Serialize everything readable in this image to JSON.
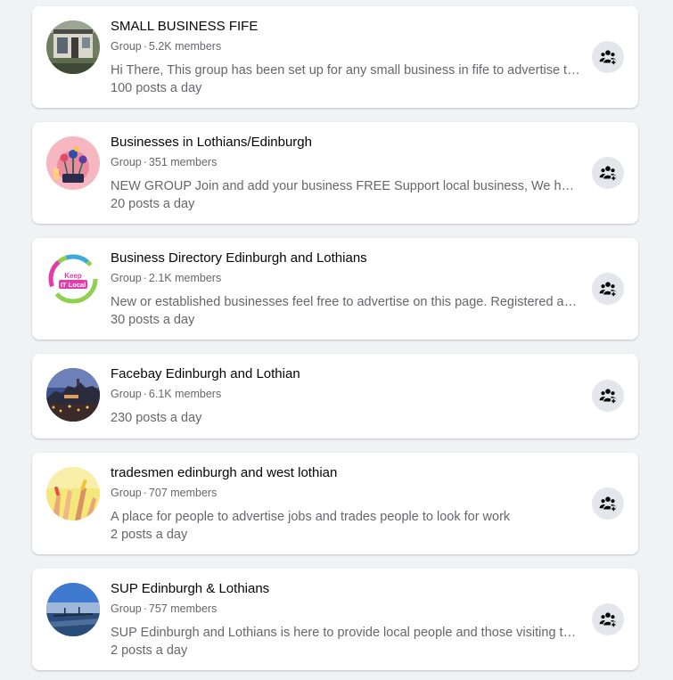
{
  "groups": [
    {
      "name": "SMALL BUSINESS FIFE",
      "type": "Group",
      "members": "5.2K members",
      "description": "Hi There, This group has been set up for any small business in fife to advertise their business and services",
      "activity": "100 posts a day",
      "avatar": "shop-storefront-photo",
      "action_icon": "join-group-icon"
    },
    {
      "name": "Businesses in Lothians/Edinburgh",
      "type": "Group",
      "members": "351 members",
      "description": "NEW GROUP Join and add your business FREE Support local business, We have created this group",
      "activity": "20 posts a day",
      "avatar": "flowers-illustration",
      "action_icon": "join-group-icon"
    },
    {
      "name": "Business Directory Edinburgh and Lothians",
      "type": "Group",
      "members": "2.1K members",
      "description": "New or established businesses feel free to advertise on this page. Registered and insured",
      "activity": "30 posts a day",
      "avatar": "keep-it-local-logo",
      "avatar_text_1": "Keep",
      "avatar_text_2": "IT Local",
      "action_icon": "join-group-icon"
    },
    {
      "name": "Facebay Edinburgh and Lothian",
      "type": "Group",
      "members": "6.1K members",
      "description": "",
      "activity": "230 posts a day",
      "avatar": "edinburgh-castle-night-photo",
      "action_icon": "join-group-icon"
    },
    {
      "name": "tradesmen edinburgh and west lothian",
      "type": "Group",
      "members": "707 members",
      "description": "A place for people to advertise jobs and trades people to look for work",
      "activity": "2 posts a day",
      "avatar": "raised-hands-photo",
      "action_icon": "join-group-icon"
    },
    {
      "name": "SUP Edinburgh & Lothians",
      "type": "Group",
      "members": "757 members",
      "description": "SUP Edinburgh and Lothians is here to provide local people and those visiting the area",
      "activity": "2 posts a day",
      "avatar": "sea-bridge-photo",
      "action_icon": "join-group-icon"
    }
  ],
  "colors": {
    "page_background": "#f0f2f5",
    "card_background": "#ffffff",
    "title_text": "#050505",
    "secondary_text": "#65676b",
    "button_background": "#e4e6eb",
    "icon": "#050505"
  }
}
